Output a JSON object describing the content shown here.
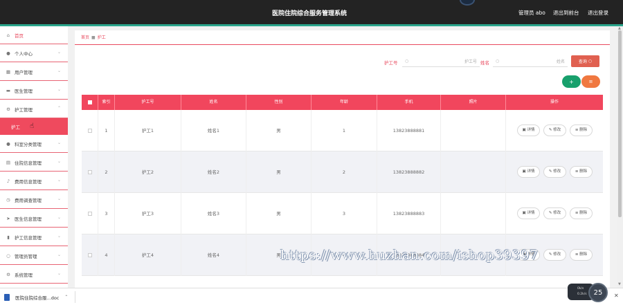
{
  "header": {
    "title": "医院住院综合服务管理系统",
    "admin": "管理员 abo",
    "back_to_front": "退出到前台",
    "logout": "退出登录"
  },
  "sidebar": {
    "items": [
      {
        "label": "首页",
        "icon": "home-icon"
      },
      {
        "label": "个人中心",
        "icon": "user-icon"
      },
      {
        "label": "用户管理",
        "icon": "users-icon"
      },
      {
        "label": "医生管理",
        "icon": "monitor-icon"
      },
      {
        "label": "护工管理",
        "icon": "gear-icon"
      },
      {
        "label": "护工",
        "icon": ""
      },
      {
        "label": "科室分类管理",
        "icon": "person-icon"
      },
      {
        "label": "住院信息管理",
        "icon": "list-icon"
      },
      {
        "label": "费用信息管理",
        "icon": "mic-icon"
      },
      {
        "label": "费用调查管理",
        "icon": "clock-icon"
      },
      {
        "label": "医生信息管理",
        "icon": "send-icon"
      },
      {
        "label": "护工信息管理",
        "icon": "bar-chart-icon"
      },
      {
        "label": "管理员管理",
        "icon": "circle-icon"
      },
      {
        "label": "系统管理",
        "icon": "settings-icon"
      }
    ]
  },
  "breadcrumb": {
    "home": "首页",
    "current": "护工"
  },
  "filters": {
    "nurse_no_label": "护工号",
    "nurse_no_placeholder": "护工号",
    "name_label": "姓名",
    "name_placeholder": "姓名",
    "query_label": "查询"
  },
  "toolbar": {
    "add_label": "+",
    "delete_label": "≡"
  },
  "table": {
    "columns": [
      "索引",
      "护工号",
      "姓名",
      "性别",
      "年龄",
      "手机",
      "照片",
      "操作"
    ],
    "rows": [
      {
        "index": "1",
        "nurse_no": "护工1",
        "name": "姓名1",
        "gender": "男",
        "age": "1",
        "phone": "13823888881"
      },
      {
        "index": "2",
        "nurse_no": "护工2",
        "name": "姓名2",
        "gender": "男",
        "age": "2",
        "phone": "13823888882"
      },
      {
        "index": "3",
        "nurse_no": "护工3",
        "name": "姓名3",
        "gender": "男",
        "age": "3",
        "phone": "13823888883"
      },
      {
        "index": "4",
        "nurse_no": "护工4",
        "name": "姓名4",
        "gender": "男",
        "age": "4",
        "phone": "13823888884"
      }
    ],
    "actions": {
      "detail": "详情",
      "edit": "修改",
      "delete": "删除"
    }
  },
  "watermark": "https://www.huzhan.com/ishop39397",
  "download": {
    "file_name": "医院住院综合服...doc"
  },
  "overlay": {
    "value": "25",
    "net_up": "0k/s",
    "net_down": "0.2k/s"
  },
  "colors": {
    "accent": "#f1465d",
    "topbar": "#232323",
    "teal": "#2aa58b",
    "add": "#18a06c",
    "delete": "#f07840",
    "query": "#e06050"
  }
}
